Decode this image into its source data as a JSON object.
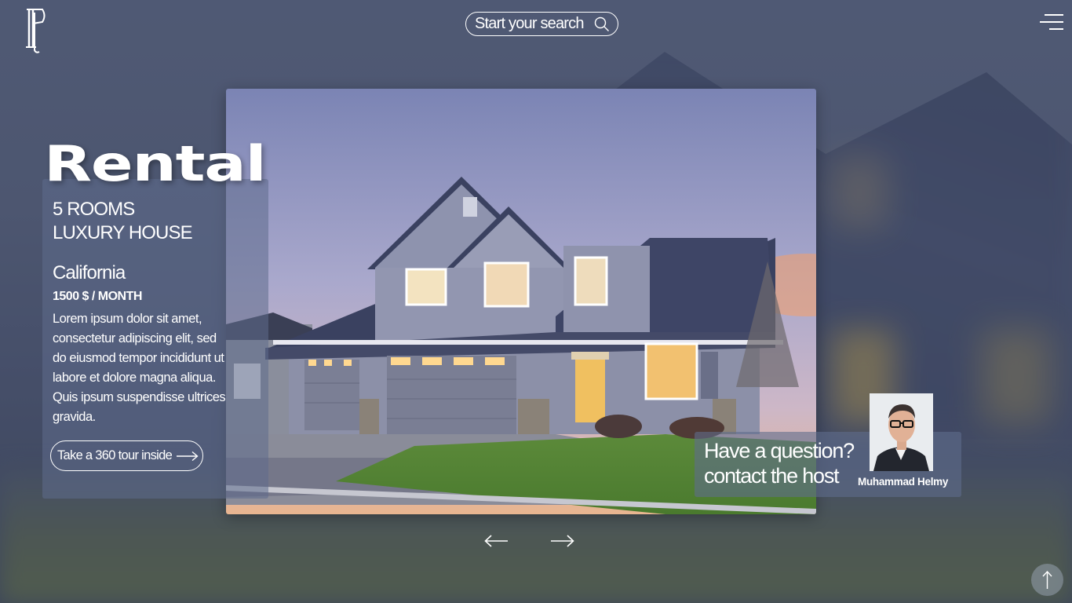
{
  "search": {
    "placeholder": "Start your search"
  },
  "listing": {
    "title": "Rental",
    "rooms_line1": "5 ROOMS",
    "rooms_line2": "LUXURY HOUSE",
    "location": "California",
    "price": "1500 $ / MONTH",
    "description": "Lorem ipsum dolor sit amet, consectetur adipiscing elit, sed do eiusmod tempor incididunt ut labore et dolore magna aliqua. Quis ipsum suspendisse ultrices gravida.",
    "tour_button_label": "Take a 360 tour inside"
  },
  "host": {
    "question": "Have a question?",
    "contact": "contact the host",
    "name": "Muhammad Helmy"
  },
  "icons": {
    "logo": "ip-monogram-logo",
    "search": "search-icon",
    "menu": "hamburger-menu-icon",
    "prev": "arrow-left-icon",
    "next": "arrow-right-icon",
    "scroll_top": "arrow-up-icon"
  },
  "colors": {
    "panel": "#5f6c8c",
    "text": "#ffffff"
  }
}
